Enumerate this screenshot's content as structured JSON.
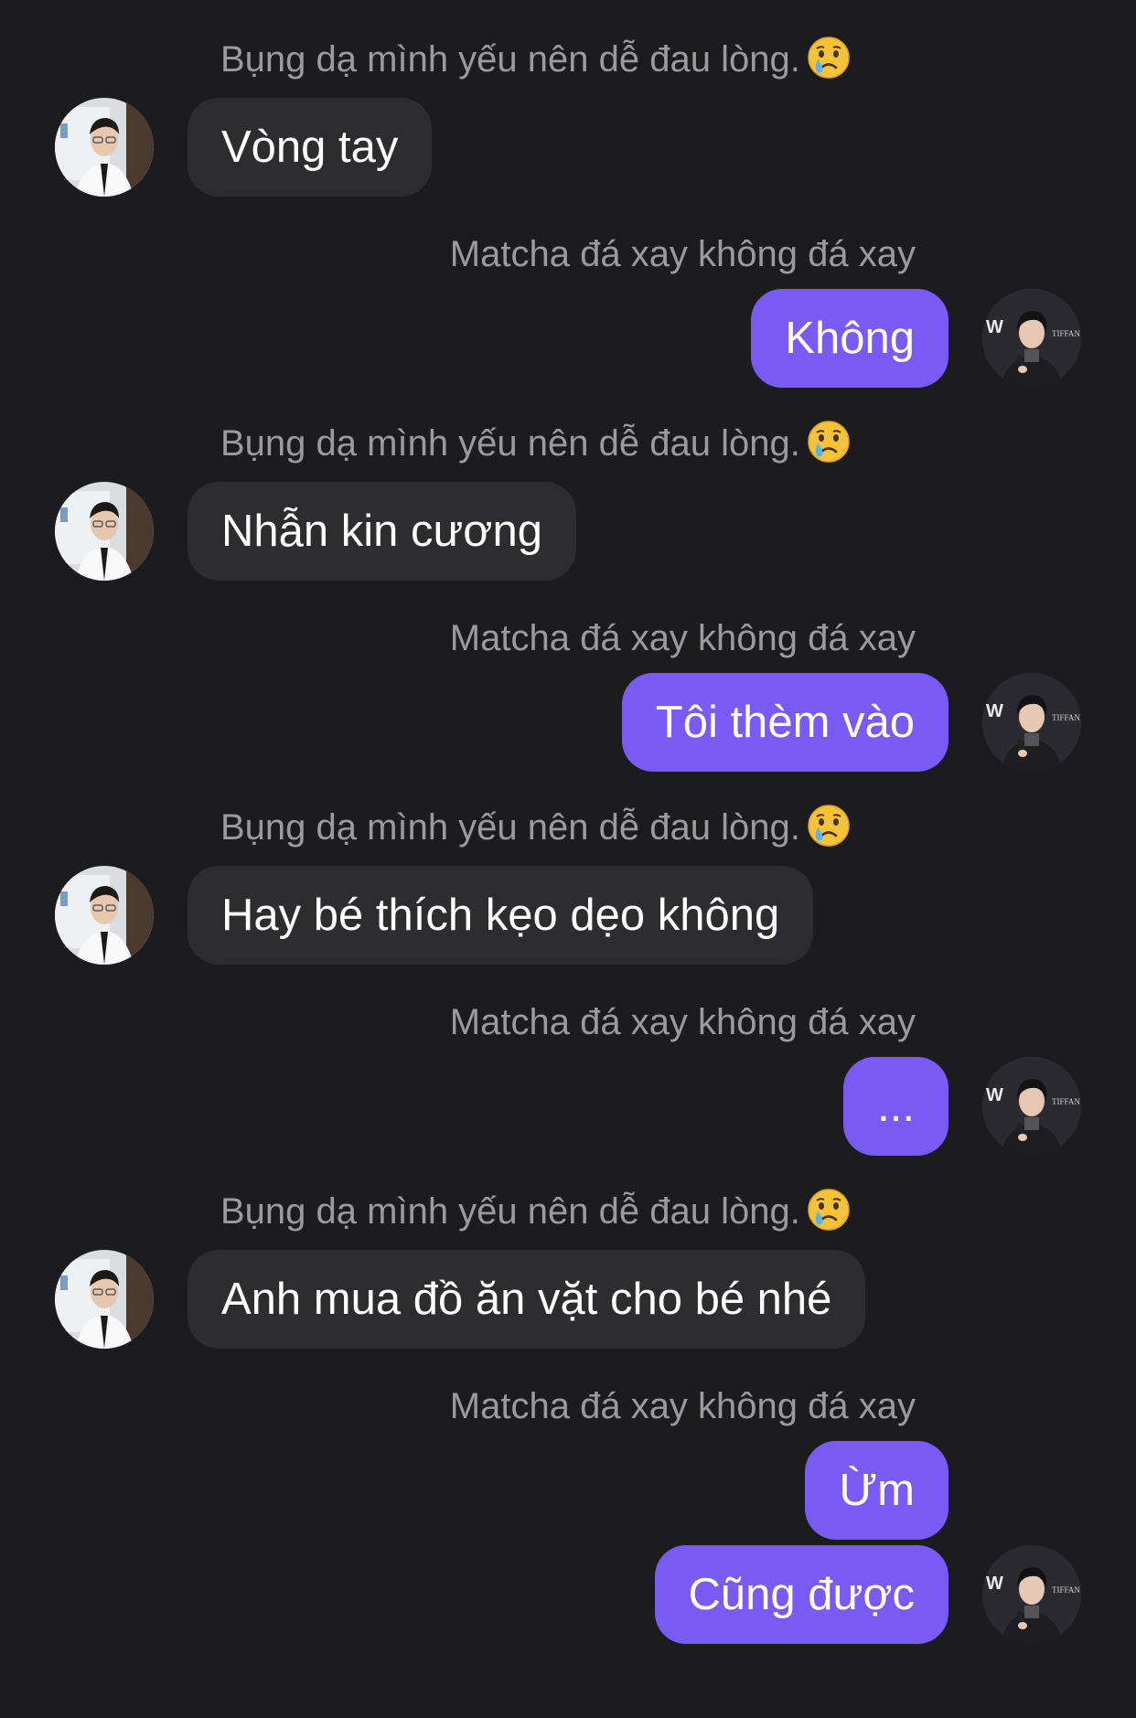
{
  "contacts": {
    "other": {
      "name": "Bụng dạ mình yếu nên dễ đau lòng.",
      "emoji": "crying-face-icon"
    },
    "me": {
      "name": "Matcha đá xay không đá xay"
    }
  },
  "messages": [
    {
      "sender": "other",
      "text": "Vòng tay"
    },
    {
      "sender": "me",
      "text": "Không"
    },
    {
      "sender": "other",
      "text": "Nhẫn kin cương"
    },
    {
      "sender": "me",
      "text": "Tôi thèm vào"
    },
    {
      "sender": "other",
      "text": "Hay bé thích kẹo dẹo không"
    },
    {
      "sender": "me",
      "text": "..."
    },
    {
      "sender": "other",
      "text": "Anh mua đồ ăn vặt cho bé nhé"
    },
    {
      "sender": "me",
      "text": "Ừm"
    },
    {
      "sender": "me",
      "text": "Cũng được"
    }
  ],
  "colors": {
    "background": "#1c1c1e",
    "incoming_bubble": "#2d2d30",
    "outgoing_bubble": "#7a5af5",
    "name_text": "#9a9aa0"
  }
}
